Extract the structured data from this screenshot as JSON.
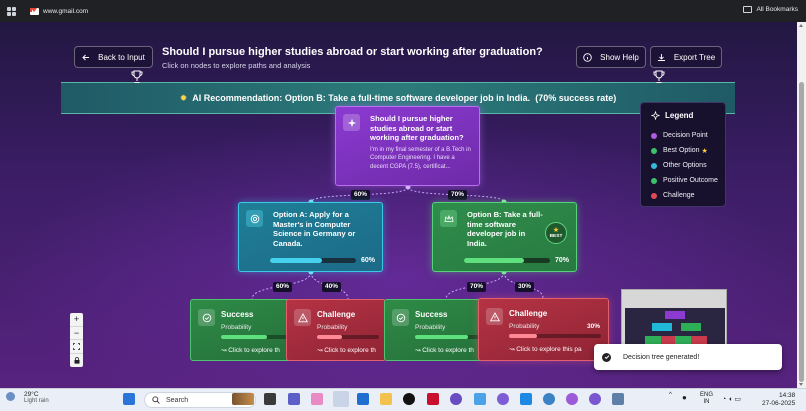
{
  "browser": {
    "bookmark_gmail": "www.gmail.com",
    "all_bookmarks": "All Bookmarks"
  },
  "header": {
    "back_label": "Back to Input",
    "title": "Should I pursue higher studies abroad or start working after graduation?",
    "subtitle": "Click on nodes to explore paths and analysis",
    "help_label": "Show Help",
    "export_label": "Export Tree"
  },
  "recommendation": {
    "prefix": "AI Recommendation:",
    "option": "Option B: Take a full-time software developer job in India.",
    "rate": "(70% success rate)"
  },
  "tree": {
    "root": {
      "title": "Should I pursue higher studies abroad or start working after graduation?",
      "desc": "I'm in my final semester of a B.Tech in Computer Engineering. I have a decent CGPA (7.5), certificat..."
    },
    "optionA": {
      "title": "Option A: Apply for a Master's in Computer Science in Germany or Canada.",
      "percent": "60%",
      "progress": 0.6,
      "edge_label": "60%"
    },
    "optionB": {
      "title": "Option B: Take a full-time software developer job in India.",
      "percent": "70%",
      "progress": 0.7,
      "edge_label": "70%",
      "best_label": "BEST"
    },
    "leaves": [
      {
        "title": "Success",
        "prob_label": "Probability",
        "percent": "",
        "progress": 0.6,
        "explore": "Click to explore th",
        "edge_label": "60%"
      },
      {
        "title": "Challenge",
        "prob_label": "Probability",
        "percent": "",
        "progress": 0.4,
        "explore": "Click to explore th",
        "edge_label": "40%"
      },
      {
        "title": "Success",
        "prob_label": "Probability",
        "percent": "",
        "progress": 0.7,
        "explore": "Click to explore th",
        "edge_label": "70%"
      },
      {
        "title": "Challenge",
        "prob_label": "Probability",
        "percent": "30%",
        "progress": 0.3,
        "explore": "Click to explore this pa",
        "edge_label": "30%"
      }
    ]
  },
  "legend": {
    "title": "Legend",
    "items": [
      {
        "label": "Decision Point",
        "color": "#b05be0"
      },
      {
        "label": "Best Option",
        "color": "#3cc06a"
      },
      {
        "label": "Other Options",
        "color": "#36b8d9"
      },
      {
        "label": "Positive Outcome",
        "color": "#3cc06a"
      },
      {
        "label": "Challenge",
        "color": "#e04a57"
      }
    ]
  },
  "toast": {
    "message": "Decision tree generated!"
  },
  "taskbar": {
    "weather_temp": "29°C",
    "weather_cond": "Light rain",
    "search_placeholder": "Search",
    "lang_top": "ENG",
    "lang_bottom": "IN",
    "time": "14:38",
    "date": "27-06-2025"
  }
}
